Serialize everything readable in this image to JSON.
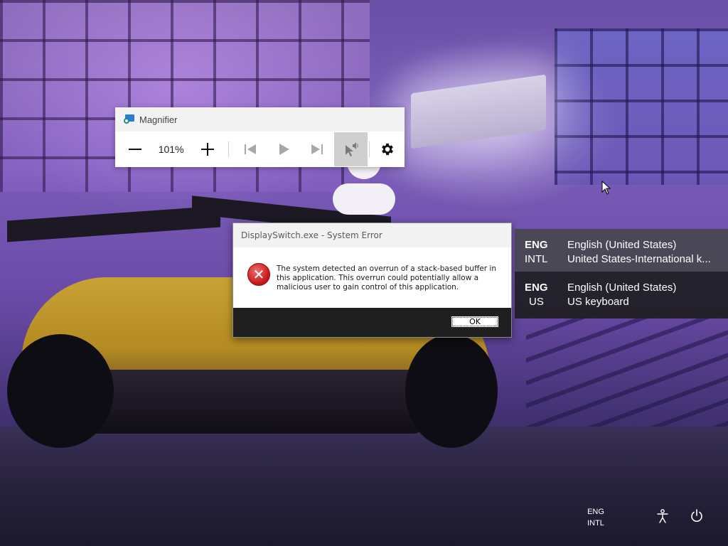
{
  "magnifier": {
    "title": "Magnifier",
    "zoom": "101%",
    "icons": {
      "app": "magnifier-app-icon",
      "zoom_out": "minus-icon",
      "zoom_in": "plus-icon",
      "previous": "skip-previous-icon",
      "play": "play-icon",
      "next": "skip-next-icon",
      "read_from_here": "read-from-here-icon",
      "settings": "gear-icon"
    }
  },
  "dialog": {
    "title": "DisplaySwitch.exe - System Error",
    "message": "The system detected an overrun of a stack-based buffer in this application. This overrun could potentially allow a malicious user to gain control of this application.",
    "ok_label": "OK",
    "icon": "error-icon"
  },
  "languages": [
    {
      "code": "ENG",
      "sub": "INTL",
      "name": "English (United States)",
      "keyboard": "United States-International k..."
    },
    {
      "code": "ENG",
      "sub": "US",
      "name": "English (United States)",
      "keyboard": "US keyboard"
    }
  ],
  "lockscreen": {
    "ime_code": "ENG",
    "ime_sub": "INTL",
    "accessibility_icon": "accessibility-icon",
    "power_icon": "power-icon"
  },
  "colors": {
    "error_red": "#c81818",
    "lang_item_active": "#46464e",
    "lang_item": "#1e1e22",
    "dialog_footer": "#1f1f1f"
  }
}
